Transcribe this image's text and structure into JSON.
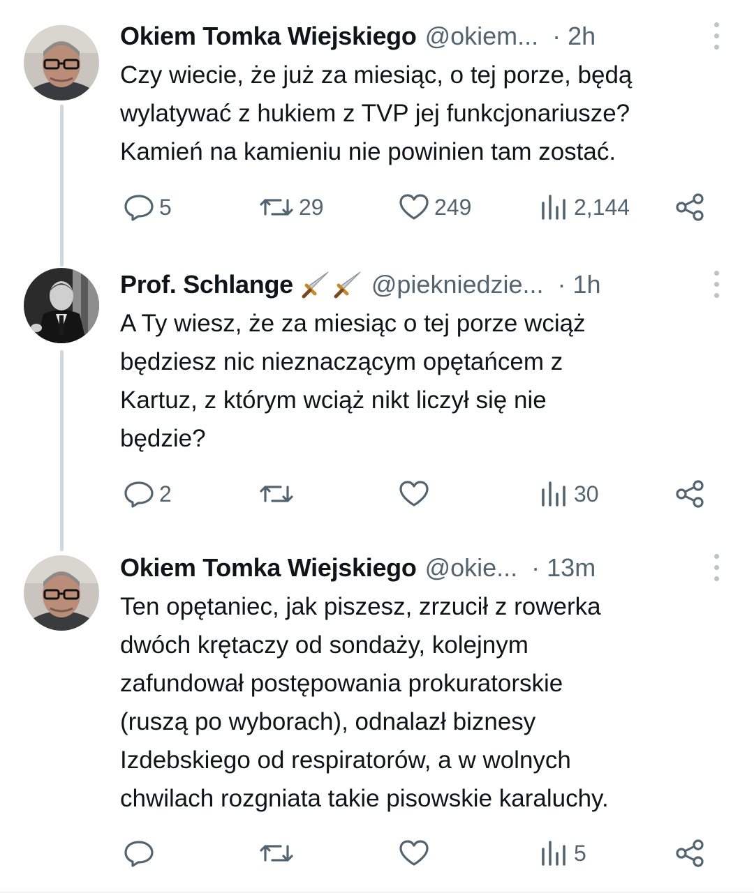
{
  "tweets": [
    {
      "name": "Okiem Tomka Wiejskiego",
      "handle": "@okiem...",
      "time": "· 2h",
      "emoji": "",
      "lines": [
        "Czy wiecie, że już za miesiąc, o tej porze, będą",
        "wylatywać z hukiem z TVP jej funkcjonariusze?",
        "Kamień na kamieniu nie powinien tam zostać."
      ],
      "replies": "5",
      "retweets": "29",
      "likes": "249",
      "views": "2,144"
    },
    {
      "name": "Prof. Schlange",
      "handle": "@piekniedzie...",
      "time": "· 1h",
      "emoji": "🗡️🗡️",
      "lines": [
        "A Ty wiesz, że za miesiąc o tej porze wciąż",
        "będziesz nic nieznaczącym opętańcem z",
        "Kartuz, z którym wciąż nikt liczył się nie",
        "będzie?"
      ],
      "replies": "2",
      "retweets": "",
      "likes": "",
      "views": "30"
    },
    {
      "name": "Okiem Tomka Wiejskiego",
      "handle": "@okie...",
      "time": "· 13m",
      "emoji": "",
      "lines": [
        "Ten opętaniec, jak piszesz, zrzucił z rowerka",
        "dwóch krętaczy od sondaży, kolejnym",
        "zafundował postępowania prokuratorskie",
        "(ruszą po wyborach), odnalazł biznesy",
        "Izdebskiego od respiratorów, a w wolnych",
        "chwilach rozgniata takie pisowskie karaluchy."
      ],
      "replies": "",
      "retweets": "",
      "likes": "",
      "views": "5"
    }
  ],
  "icons": {
    "reply": "reply-icon",
    "retweet": "retweet-icon",
    "like": "heart-icon",
    "views": "views-icon",
    "share": "share-icon",
    "more": "more-vertical-icon"
  },
  "colors": {
    "text": "#0f1419",
    "muted": "#536471",
    "thread_line": "#cfd9de"
  }
}
